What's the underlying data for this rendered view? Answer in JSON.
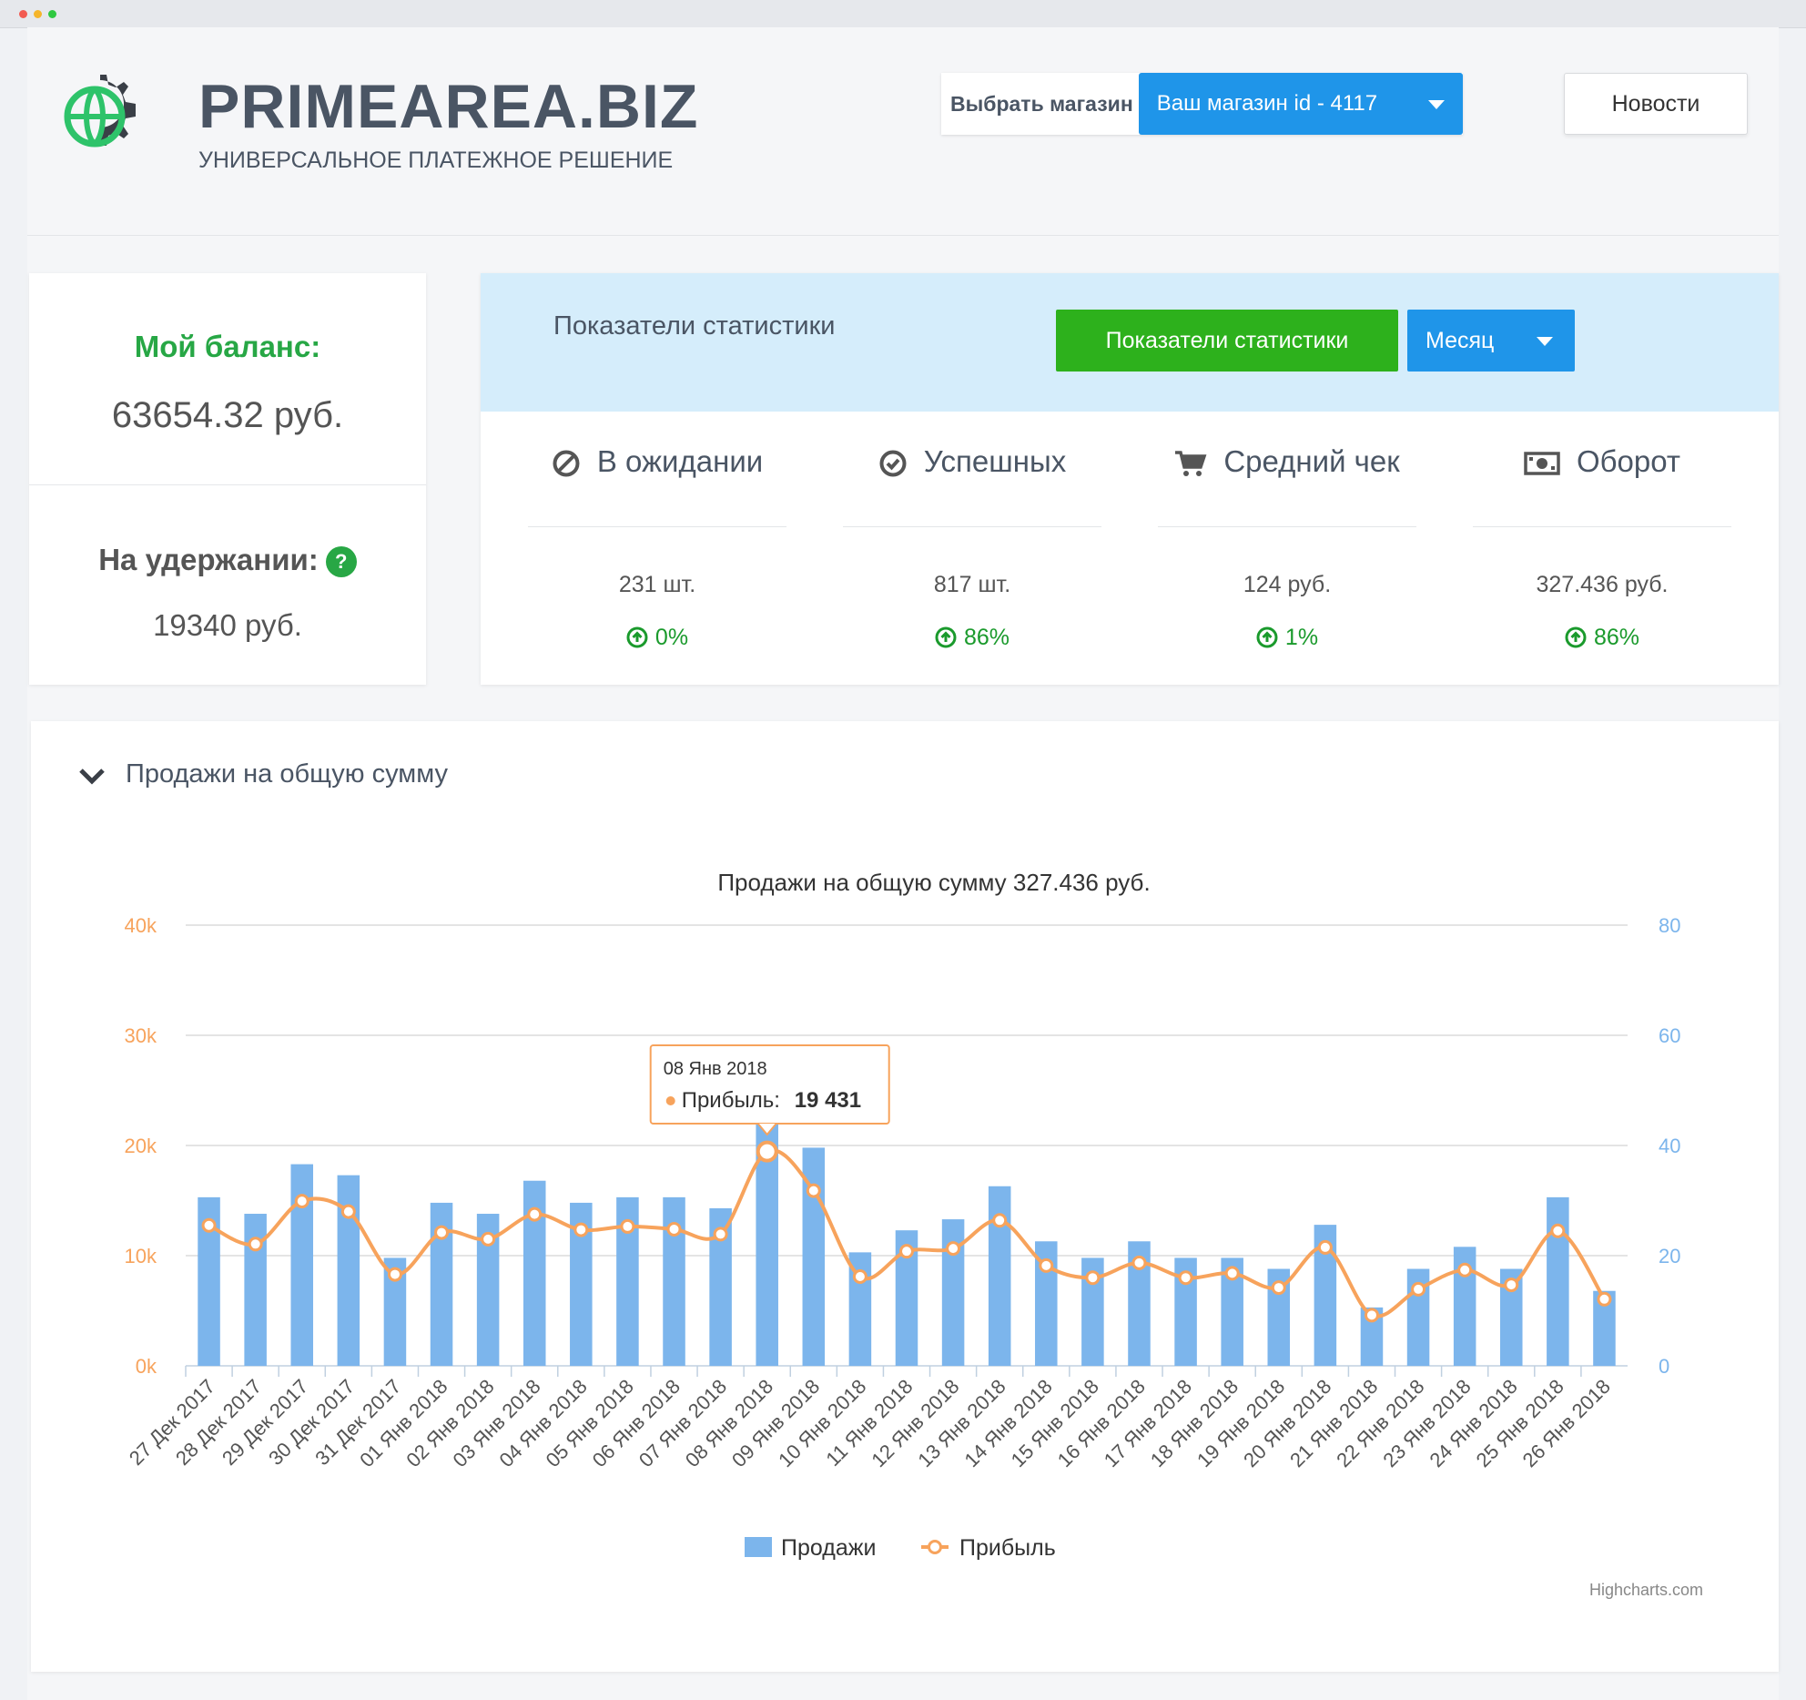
{
  "brand": {
    "name": "PRIMEAREA.BIZ",
    "tagline": "УНИВЕРСАЛЬНОЕ ПЛАТЕЖНОЕ РЕШЕНИЕ"
  },
  "header": {
    "shop_label": "Выбрать магазин",
    "shop_value": "Ваш магазин id - 4117",
    "news_label": "Новости"
  },
  "balance": {
    "title": "Мой баланс:",
    "value": "63654.32 руб.",
    "hold_title": "На удержании:",
    "hold_help": "?",
    "hold_value": "19340 руб."
  },
  "stats": {
    "title": "Показатели статистики",
    "button_label": "Показатели статистики",
    "period": "Месяц",
    "metrics": [
      {
        "icon": "ban-icon",
        "label": "В ожидании",
        "value": "231 шт.",
        "change": "0%"
      },
      {
        "icon": "check-circle-icon",
        "label": "Успешных",
        "value": "817 шт.",
        "change": "86%"
      },
      {
        "icon": "cart-icon",
        "label": "Средний чек",
        "value": "124 руб.",
        "change": "1%"
      },
      {
        "icon": "money-icon",
        "label": "Оборот",
        "value": "327.436 руб.",
        "change": "86%"
      }
    ]
  },
  "chart_section": {
    "title": "Продажи на общую сумму",
    "credits": "Highcharts.com"
  },
  "chart_data": {
    "type": "bar",
    "title": "Продажи на общую сумму 327.436 руб.",
    "categories": [
      "27 Дек 2017",
      "28 Дек 2017",
      "29 Дек 2017",
      "30 Дек 2017",
      "31 Дек 2017",
      "01 Янв 2018",
      "02 Янв 2018",
      "03 Янв 2018",
      "04 Янв 2018",
      "05 Янв 2018",
      "06 Янв 2018",
      "07 Янв 2018",
      "08 Янв 2018",
      "09 Янв 2018",
      "10 Янв 2018",
      "11 Янв 2018",
      "12 Янв 2018",
      "13 Янв 2018",
      "14 Янв 2018",
      "15 Янв 2018",
      "16 Янв 2018",
      "17 Янв 2018",
      "18 Янв 2018",
      "19 Янв 2018",
      "20 Янв 2018",
      "21 Янв 2018",
      "22 Янв 2018",
      "23 Янв 2018",
      "24 Янв 2018",
      "25 Янв 2018",
      "26 Янв 2018"
    ],
    "y_left": {
      "ticks": [
        "0k",
        "10k",
        "20k",
        "30k",
        "40k"
      ],
      "ylim": [
        0,
        40000
      ]
    },
    "y_right": {
      "ticks": [
        "0",
        "20",
        "40",
        "60",
        "80"
      ],
      "ylim": [
        0,
        80
      ]
    },
    "series": [
      {
        "name": "Продажи",
        "type": "bar",
        "color": "#7cb5ec",
        "axis": "left",
        "values": [
          15300,
          13800,
          18300,
          17300,
          9800,
          14800,
          13800,
          16800,
          14800,
          15300,
          15300,
          14300,
          22200,
          19800,
          10300,
          12300,
          13300,
          16300,
          11300,
          9800,
          11300,
          9800,
          9800,
          8800,
          12800,
          5300,
          8800,
          10800,
          8800,
          15300,
          6800
        ]
      },
      {
        "name": "Прибыль",
        "type": "line",
        "color": "#f7a35c",
        "axis": "right",
        "values": [
          25.5,
          22.1,
          29.9,
          28.0,
          16.6,
          24.2,
          23.0,
          27.5,
          24.7,
          25.3,
          24.8,
          23.9,
          38.9,
          31.8,
          16.2,
          20.8,
          21.3,
          26.4,
          18.2,
          16.0,
          18.7,
          16.0,
          16.8,
          14.2,
          21.5,
          9.2,
          13.9,
          17.4,
          14.7,
          24.5,
          12.1
        ]
      }
    ],
    "legend": [
      "Продажи",
      "Прибыль"
    ],
    "legend_position": "bottom",
    "tooltip": {
      "date": "08 Янв 2018",
      "series": "Прибыль",
      "value": "19 431",
      "index": 12
    }
  },
  "colors": {
    "accent_blue": "#1f95e9",
    "green": "#2db11c",
    "balance_green": "#27a745",
    "bar_blue": "#7cb5ec",
    "line_orange": "#f7a35c",
    "axis_orange": "#f7a35c",
    "axis_blue": "#7cb5ec"
  }
}
